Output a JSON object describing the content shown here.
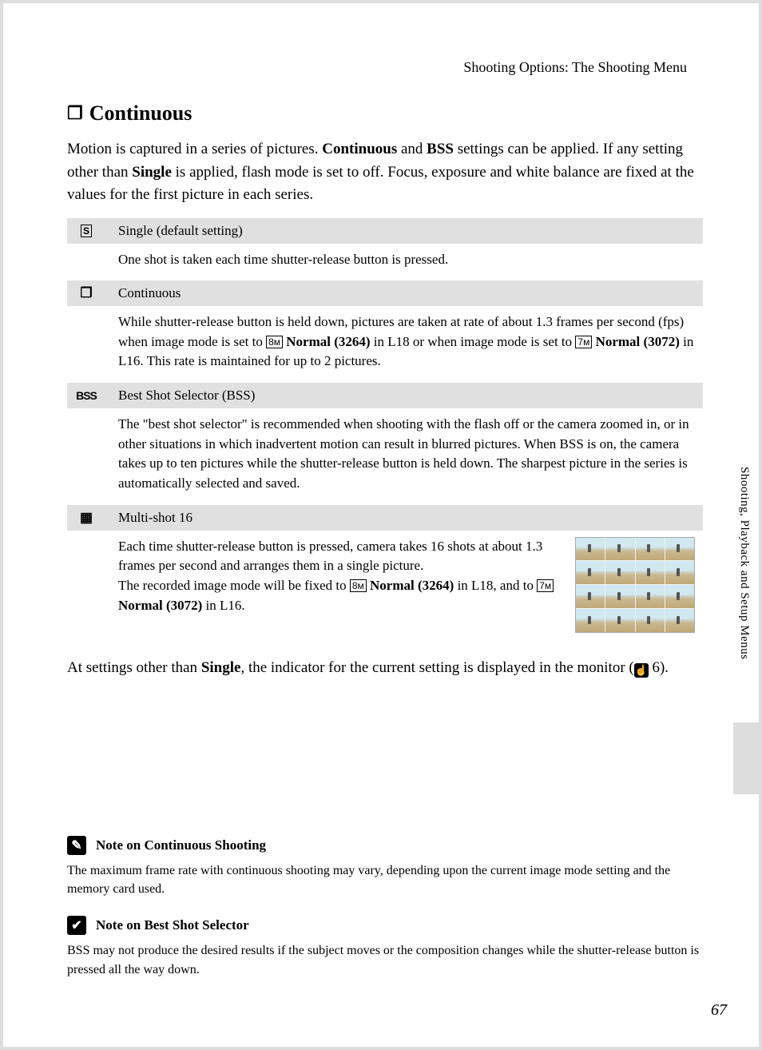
{
  "section_header": "Shooting Options: The Shooting Menu",
  "title": "Continuous",
  "intro": {
    "p1a": "Motion is captured in a series of pictures. ",
    "p1b": "Continuous",
    "p1c": " and ",
    "p1d": "BSS",
    "p1e": " settings can be applied. If any setting other than ",
    "p1f": "Single",
    "p1g": " is applied, flash mode is set to off. Focus, exposure and white balance are fixed at the values for the first picture in each series."
  },
  "rows": {
    "single": {
      "icon": "S",
      "label": "Single (default setting)",
      "body": "One shot is taken each time shutter-release button is pressed."
    },
    "continuous": {
      "label": "Continuous",
      "b1": "While shutter-release button is held down, pictures are taken at rate of about 1.3 frames per second (fps) when image mode is set to ",
      "b2": "8ᴍ",
      "b3": " Normal (3264)",
      "b4": " in L18 or when image mode is set to ",
      "b5": "7ᴍ",
      "b6": " Normal (3072)",
      "b7": " in L16. This rate is maintained for up to 2 pictures."
    },
    "bss": {
      "icon": "BSS",
      "label": "Best Shot Selector (BSS)",
      "body": "The \"best shot selector\" is recommended when shooting with the flash off or the camera zoomed in, or in other situations in which inadvertent motion can result in blurred pictures. When BSS is on, the camera takes up to ten pictures while the shutter-release button is held down. The sharpest picture in the series is automatically selected and saved."
    },
    "multi": {
      "label": "Multi-shot 16",
      "b1": "Each time shutter-release button is pressed, camera takes 16 shots at about 1.3 frames per second and arranges them in a single picture.",
      "b2": "The recorded image mode will be fixed to ",
      "b3": "8ᴍ",
      "b4": " Normal (3264)",
      "b5": " in L18, and to ",
      "b6": "7ᴍ",
      "b7": " Normal (3072)",
      "b8": " in L16."
    }
  },
  "bottom": {
    "a": "At settings other than ",
    "b": "Single",
    "c": ", the indicator for the current setting is displayed in the monitor (",
    "d": " 6)."
  },
  "side_tab": "Shooting, Playback and Setup Menus",
  "note1": {
    "title": "Note on Continuous Shooting",
    "body": "The maximum frame rate with continuous shooting may vary, depending upon the current image mode setting and the memory card used."
  },
  "note2": {
    "title": "Note on Best Shot Selector",
    "body": "BSS may not produce the desired results if the subject moves or the composition changes while the shutter-release button is pressed all the way down."
  },
  "page_number": "67"
}
